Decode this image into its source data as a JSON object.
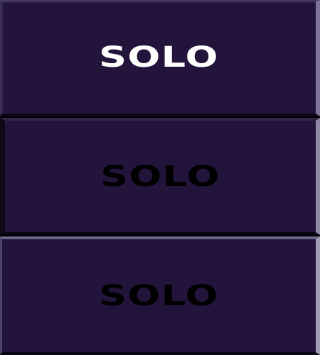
{
  "buttons": [
    {
      "label": "SOLO",
      "state": "active",
      "text_color": "#ffffff"
    },
    {
      "label": "SOLO",
      "state": "inactive",
      "text_color": "#000000"
    },
    {
      "label": "SOLO",
      "state": "inactive",
      "text_color": "#000000"
    }
  ],
  "colors": {
    "button_face": "#22143b",
    "background": "#000000",
    "highlight_edge": "#8f87a6"
  }
}
